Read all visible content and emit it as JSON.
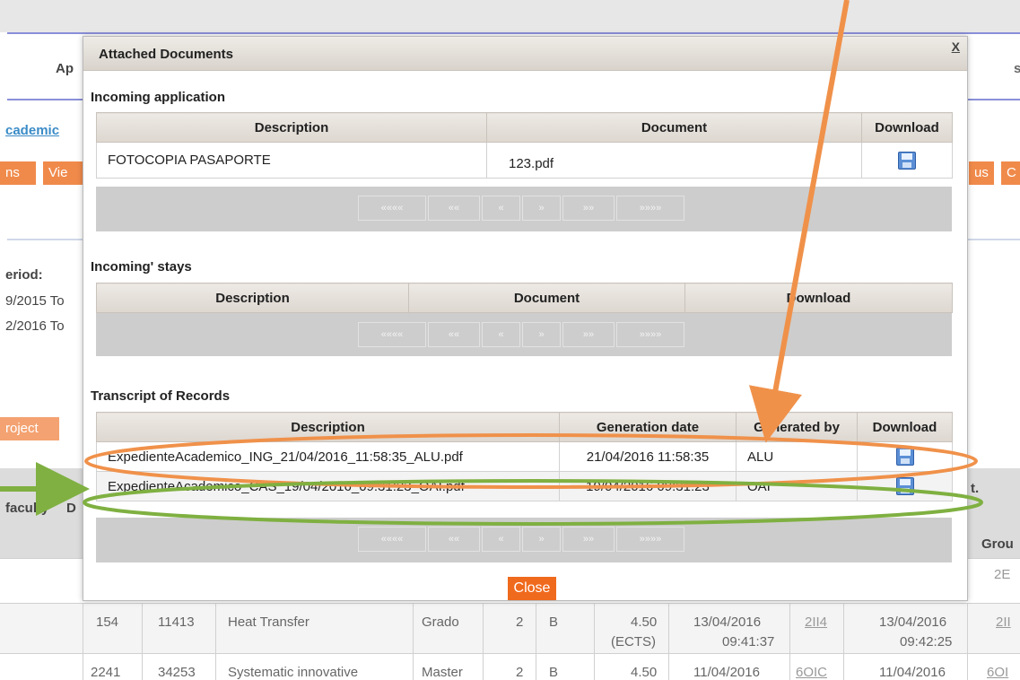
{
  "background": {
    "frag_app": "Ap",
    "frag_s": "s",
    "frag_academic": "cademic",
    "btn_ns": "ns",
    "btn_vie": "Vie",
    "btn_us": "us",
    "btn_c": "C",
    "period_label": "eriod:",
    "period_line1": "9/2015 To",
    "period_line2": "2/2016 To",
    "btn_project": "roject",
    "frag_t": "t.",
    "col_faculty": "faculty",
    "col_d": "D",
    "col_grou": "Grou",
    "frag_2e": "2E",
    "rows": [
      {
        "c1": "154",
        "c2": "11413",
        "c3": "Heat Transfer",
        "c4": "Grado",
        "c5": "2",
        "c6": "B",
        "c7a": "4.50",
        "c7b": "(ECTS)",
        "c8a": "13/04/2016",
        "c8b": "09:41:37",
        "c9": "2II4",
        "c10a": "13/04/2016",
        "c10b": "09:42:25",
        "c11": "2II"
      },
      {
        "c1": "2241",
        "c2": "34253",
        "c3": "Systematic innovative",
        "c4": "Master",
        "c5": "2",
        "c6": "B",
        "c7a": "4.50",
        "c8a": "11/04/2016",
        "c9": "6OIC",
        "c10a": "11/04/2016",
        "c11": "6OI"
      }
    ]
  },
  "modal": {
    "title": "Attached Documents",
    "close_x": "X",
    "close_label": "Close",
    "pager": [
      "«««« ",
      "«« ",
      "« ",
      "» ",
      "»» ",
      "»»»» "
    ],
    "incoming_application": {
      "title": "Incoming application",
      "headers": [
        "Description",
        "Document",
        "Download"
      ],
      "rows": [
        {
          "description": "FOTOCOPIA PASAPORTE",
          "document": "123.pdf",
          "download_icon": "save-icon"
        }
      ]
    },
    "incoming_stays": {
      "title": "Incoming' stays",
      "headers": [
        "Description",
        "Document",
        "Download"
      ]
    },
    "transcript": {
      "title": "Transcript of Records",
      "headers": [
        "Description",
        "Generation date",
        "Generated by",
        "Download"
      ],
      "rows": [
        {
          "description": "ExpedienteAcademico_ING_21/04/2016_11:58:35_ALU.pdf",
          "date": "21/04/2016 11:58:35",
          "by": "ALU",
          "download_icon": "save-icon"
        },
        {
          "description": "ExpedienteAcademico_CAS_19/04/2016_09:31:23_OAI.pdf",
          "date": "19/04/2016 09:31:23",
          "by": "OAI",
          "download_icon": "save-icon"
        }
      ]
    }
  },
  "annotations": {
    "orange": "#f0914a",
    "green": "#7fb041"
  }
}
